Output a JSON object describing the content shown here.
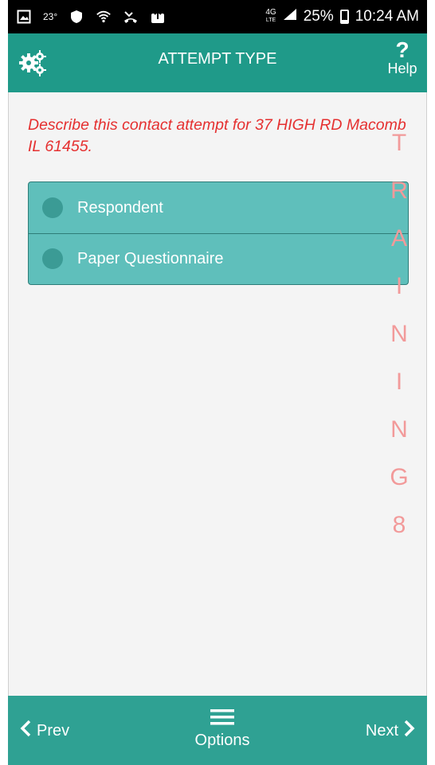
{
  "status_bar": {
    "temperature": "23°",
    "network_type": "4G",
    "network_sub": "LTE",
    "battery": "25%",
    "time": "10:24 AM"
  },
  "header": {
    "title": "ATTEMPT TYPE",
    "help_label": "Help"
  },
  "question": {
    "prompt": "Describe this contact attempt for 37 HIGH RD Macomb IL 61455."
  },
  "choices": [
    {
      "label": "Respondent"
    },
    {
      "label": "Paper Questionnaire"
    }
  ],
  "watermark": [
    "T",
    "R",
    "A",
    "I",
    "N",
    "I",
    "N",
    "G",
    "8"
  ],
  "footer": {
    "prev_label": "Prev",
    "options_label": "Options",
    "next_label": "Next"
  },
  "colors": {
    "header": "#1f9a89",
    "footer": "#2fa193",
    "choice_background": "#5fbfbb",
    "prompt_text": "#e53030",
    "watermark": "#f29a9a"
  }
}
